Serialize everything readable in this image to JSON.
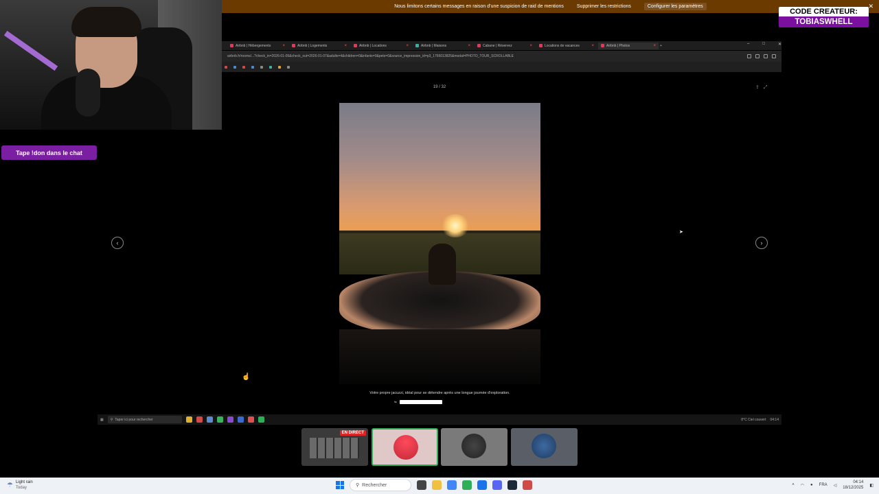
{
  "banner": {
    "message": "Nous limitons certains messages en raison d’une suspicion de raid de mentions",
    "remove_label": "Supprimer les restrictions",
    "configure_label": "Configurer les paramètres",
    "close_glyph": "✕"
  },
  "creator": {
    "line1": "CODE CREATEUR:",
    "line2": "TOBIASWHELL"
  },
  "chat_prompt": "Tape !don dans le chat",
  "browser": {
    "tabs": [
      "Airbnb | Hébergements",
      "Airbnb | Logements",
      "Airbnb | Locations",
      "Airbnb | Maisons",
      "Cabane | Réservez",
      "Locations de vacances",
      "Airbnb | Photos"
    ],
    "url": "airbnb.fr/rooms/...?check_in=2026-01-09&check_out=2026-01-07&adults=4&children=0&infants=0&pets=0&source_impression_id=p3_1766013825&modal=PHOTO_TOUR_SCROLLABLE"
  },
  "gallery": {
    "counter": "19 / 32",
    "caption": "Votre propre jacuzzi, idéal pour se détendre après une longue journée d'exploration.",
    "icons": [
      "share-icon",
      "expand-icon"
    ]
  },
  "inner_taskbar": {
    "search_placeholder": "Taper ici pour rechercher",
    "weather": "8°C Ciel couvert",
    "clock": "04:14"
  },
  "participants": {
    "live_label": "EN DIRECT"
  },
  "taskbar": {
    "weather_line1": "Light rain",
    "weather_line2": "Today",
    "search_label": "Rechercher",
    "lang": "FRA",
    "time": "04:14",
    "date": "18/12/2025"
  },
  "colors": {
    "banner": "#6a3a00",
    "chat_button": "#7a1fa2",
    "creator_accent": "#7a0fa0",
    "live": "#e02424",
    "active_tile_border": "#2fae5a"
  }
}
